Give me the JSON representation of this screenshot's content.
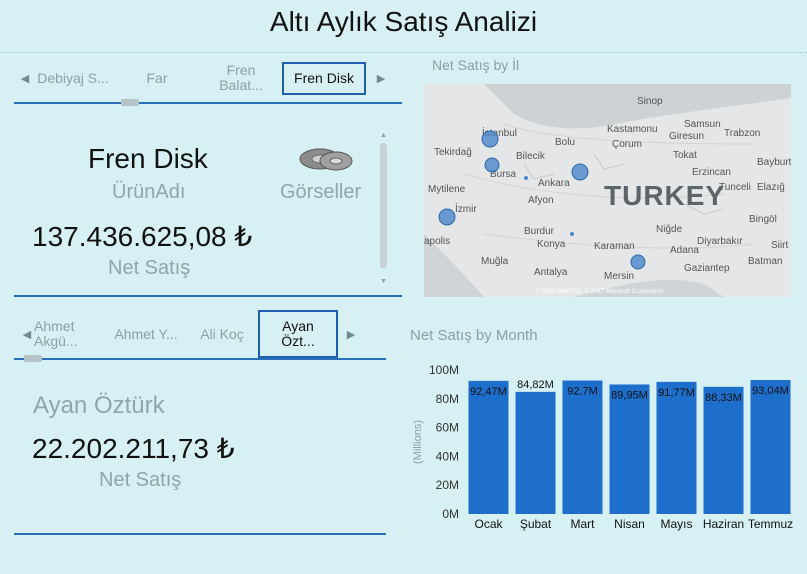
{
  "page": {
    "title": "Altı Aylık Satış Analizi"
  },
  "product_slicer": {
    "items": [
      "Debiyaj S...",
      "Far",
      "Fren Balat...",
      "Fren Disk"
    ],
    "selected_index": 3
  },
  "product_card": {
    "product_name": "Fren Disk",
    "product_label": "ÜrünAdı",
    "image_label": "Görseller",
    "net_sales": "137.436.625,08 ₺",
    "net_sales_label": "Net Satış"
  },
  "employee_slicer": {
    "items": [
      "Ahmet Akgü...",
      "Ahmet Y...",
      "Ali Koç",
      "Ayan Özt..."
    ],
    "selected_index": 3
  },
  "employee_card": {
    "name": "Ayan Öztürk",
    "net_sales": "22.202.211,73 ₺",
    "net_sales_label": "Net Satış"
  },
  "map": {
    "title": "Net Satış by İl",
    "country_label": "TURKEY",
    "place_labels": [
      "İstanbul",
      "Sinop",
      "Samsun",
      "Kastamonu",
      "Giresun",
      "Trabzon",
      "Tekirdağ",
      "Bolu",
      "Çorum",
      "Tokat",
      "Bayburt",
      "Bursa",
      "Bilecik",
      "Ankara",
      "Erzincan",
      "Mytilene",
      "Afyon",
      "Tunceli",
      "Elazığ",
      "İzmir",
      "Niğde",
      "Bingöl",
      "Burdur",
      "Konya",
      "Diyarbakır",
      "Karaman",
      "Adana",
      "Muğla",
      "Antalya",
      "Mersin",
      "Gaziantep",
      "Siirt",
      "Batman",
      "apolis"
    ],
    "copyright": "© 2010 NAVTEQ, © 2017 Microsoft Corporation",
    "bubble_color": "#4a86c8"
  },
  "chart_data": {
    "type": "bar",
    "title": "Net Satış by Month",
    "categories": [
      "Ocak",
      "Şubat",
      "Mart",
      "Nisan",
      "Mayıs",
      "Haziran",
      "Temmuz"
    ],
    "values": [
      92.47,
      84.82,
      92.7,
      89.95,
      91.77,
      88.33,
      93.04
    ],
    "data_labels": [
      "92,47M",
      "84,82M",
      "92,7M",
      "89,95M",
      "91,77M",
      "88,33M",
      "93,04M"
    ],
    "ylabel": "(Millions)",
    "yticks": [
      "0M",
      "20M",
      "40M",
      "60M",
      "80M",
      "100M"
    ],
    "ylim": [
      0,
      100
    ],
    "bar_color": "#1e6fcc",
    "grid": false
  }
}
